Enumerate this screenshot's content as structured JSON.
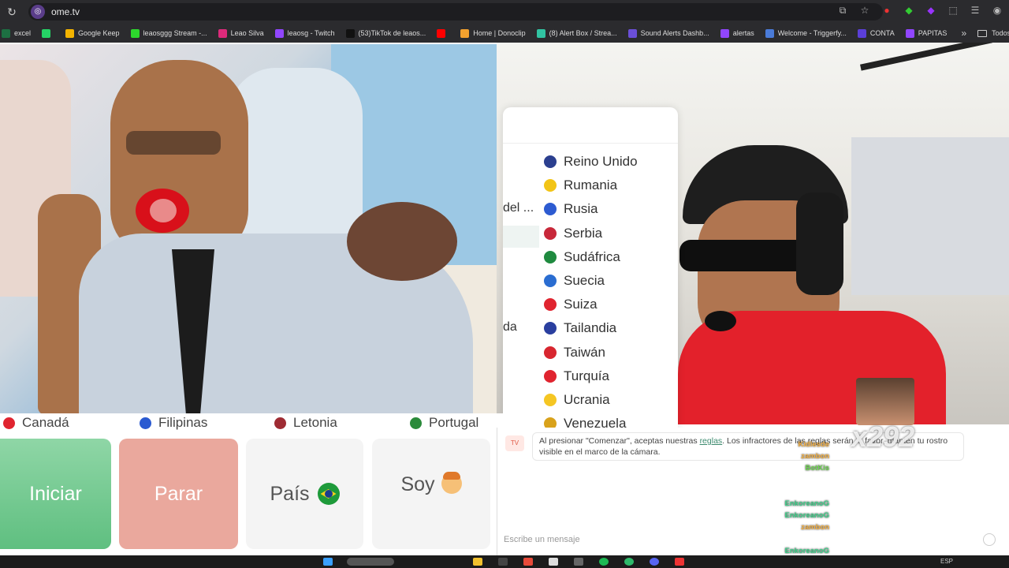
{
  "browser": {
    "url": "ome.tv",
    "bookmarks": [
      {
        "label": "excel",
        "color": "#1d6f42"
      },
      {
        "label": "",
        "color": "#25d366"
      },
      {
        "label": "Google Keep",
        "color": "#f4b400"
      },
      {
        "label": "leaosggg Stream -...",
        "color": "#2dd82d"
      },
      {
        "label": "Leao Silva",
        "color": "#dd2a7b"
      },
      {
        "label": "leaosg - Twitch",
        "color": "#9146ff"
      },
      {
        "label": "(53)TikTok de leaos...",
        "color": "#111111"
      },
      {
        "label": "",
        "color": "#ff0000"
      },
      {
        "label": "Home | Donoclip",
        "color": "#f2a12e"
      },
      {
        "label": "(8) Alert Box / Strea...",
        "color": "#31c3a2"
      },
      {
        "label": "Sound Alerts Dashb...",
        "color": "#6b4fd8"
      },
      {
        "label": "alertas",
        "color": "#9146ff"
      },
      {
        "label": "Welcome - Triggerfy...",
        "color": "#4a7bd8"
      },
      {
        "label": "CONTA",
        "color": "#5b3fd8"
      },
      {
        "label": "PAPITAS",
        "color": "#9146ff"
      }
    ],
    "bookmarks_more": "»",
    "all_bookmarks": "Todos los mar"
  },
  "dropdown": {
    "left_partial": [
      "del ...",
      "da"
    ],
    "items": [
      {
        "label": "Reino Unido",
        "flag": "#2b3f8f"
      },
      {
        "label": "Rumania",
        "flag": "#f2c416"
      },
      {
        "label": "Rusia",
        "flag": "#2d5bd1"
      },
      {
        "label": "Serbia",
        "flag": "#c8283a"
      },
      {
        "label": "Sudáfrica",
        "flag": "#1f8a3f"
      },
      {
        "label": "Suecia",
        "flag": "#2a6dd1"
      },
      {
        "label": "Suiza",
        "flag": "#e0242f"
      },
      {
        "label": "Tailandia",
        "flag": "#2a3f9f"
      },
      {
        "label": "Taiwán",
        "flag": "#d8262f"
      },
      {
        "label": "Turquía",
        "flag": "#e0242f"
      },
      {
        "label": "Ucrania",
        "flag": "#f5c623"
      },
      {
        "label": "Venezuela",
        "flag": "#d9a21b"
      }
    ]
  },
  "countries_row": [
    {
      "label": "Canadá",
      "flag": "#e0242f"
    },
    {
      "label": "Filipinas",
      "flag": "#2a5ad1"
    },
    {
      "label": "Letonia",
      "flag": "#9e2b33"
    },
    {
      "label": "Portugal",
      "flag": "#2a8a3a"
    }
  ],
  "controls": {
    "start": "Iniciar",
    "stop": "Parar",
    "country": "País",
    "me": "Soy"
  },
  "chat": {
    "logo": "TV",
    "notice_before": "Al presionar \"Comenzar\", aceptas nuestras ",
    "notice_link": "reglas",
    "notice_after": ". Los infractores de las reglas serán ... favor, mantén tu rostro visible en el marco de la cámara.",
    "input_placeholder": "Escribe un mensaje"
  },
  "stream_overlay": {
    "combo": "x292",
    "chat_lines": [
      {
        "user": "Kidlesde",
        "color": "#f5b041"
      },
      {
        "user": "zambon",
        "color": "#f5b041"
      },
      {
        "user": "BotKis",
        "color": "#6dd64f"
      },
      {
        "user": "EnkoreanoG",
        "color": "#3ed18a"
      },
      {
        "user": "EnkoreanoG",
        "color": "#3ed18a"
      },
      {
        "user": "zambon",
        "color": "#f5b041"
      },
      {
        "user": "EnkoreanoG",
        "color": "#3ed18a"
      },
      {
        "user": "EnkoreanoG",
        "color": "#3ed18a"
      }
    ]
  },
  "taskbar": {
    "lang": "ESP"
  }
}
